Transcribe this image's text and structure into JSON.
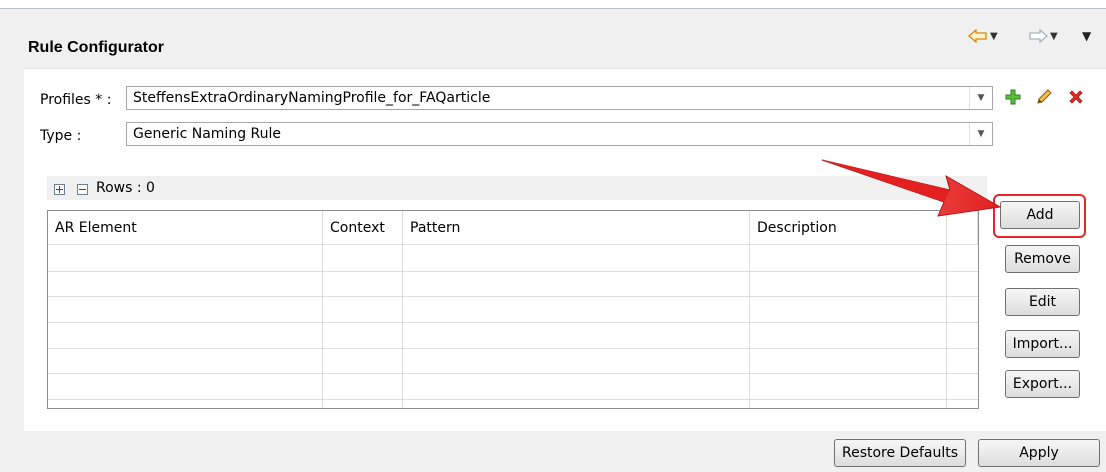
{
  "title": "Rule Configurator",
  "profiles": {
    "label": "Profiles * :",
    "value": "SteffensExtraOrdinaryNamingProfile_for_FAQarticle"
  },
  "type": {
    "label": "Type :",
    "value": "Generic Naming Rule"
  },
  "rows_label": "Rows : 0",
  "table": {
    "columns": [
      "AR Element",
      "Context",
      "Pattern",
      "Description"
    ]
  },
  "buttons": {
    "add": "Add",
    "remove": "Remove",
    "edit": "Edit",
    "import": "Import...",
    "export": "Export...",
    "restore_defaults": "Restore Defaults",
    "apply": "Apply"
  },
  "icons": [
    "back-arrow-icon",
    "forward-arrow-icon",
    "view-menu-icon",
    "add-profile-icon",
    "edit-profile-icon",
    "delete-profile-icon",
    "expand-all-icon",
    "collapse-all-icon"
  ],
  "colors": {
    "highlight_red": "#e8262b",
    "add_green": "#4caf2e",
    "delete_red": "#d9261c",
    "nav_orange": "#e0a020"
  }
}
